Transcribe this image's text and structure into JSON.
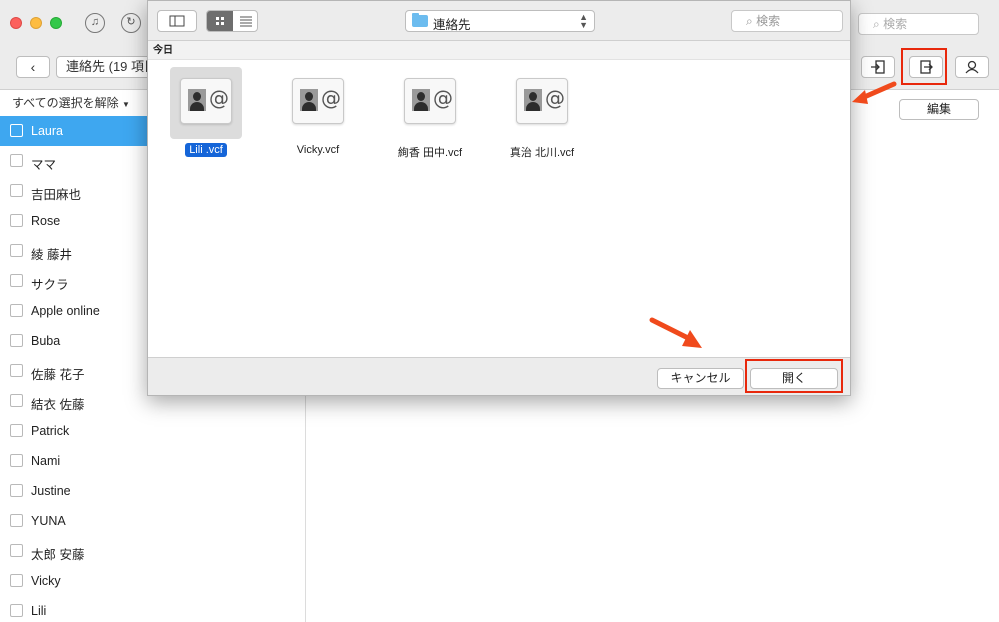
{
  "main": {
    "toolbar": {
      "back_icon": "‹",
      "title_label": "連絡先 (19 項目",
      "search_placeholder": "検索",
      "edit_label": "編集"
    },
    "sidebar": {
      "deselect_label": "すべての選択を解除",
      "contacts": [
        {
          "name": "Laura",
          "selected": true
        },
        {
          "name": "ママ"
        },
        {
          "name": "吉田麻也"
        },
        {
          "name": "Rose"
        },
        {
          "name": "綾 藤井"
        },
        {
          "name": "サクラ"
        },
        {
          "name": "Apple online"
        },
        {
          "name": "Buba"
        },
        {
          "name": "佐藤 花子"
        },
        {
          "name": "結衣 佐藤"
        },
        {
          "name": "Patrick"
        },
        {
          "name": "Nami"
        },
        {
          "name": "Justine"
        },
        {
          "name": "YUNA"
        },
        {
          "name": "太郎 安藤"
        },
        {
          "name": "Vicky"
        },
        {
          "name": "Lili"
        }
      ]
    }
  },
  "dialog": {
    "location": "連絡先",
    "search_placeholder": "検索",
    "section_label": "今日",
    "files": [
      {
        "name": "Lili .vcf",
        "selected": true
      },
      {
        "name": "Vicky.vcf"
      },
      {
        "name": "絢香 田中.vcf"
      },
      {
        "name": "真治 北川.vcf"
      }
    ],
    "cancel_label": "キャンセル",
    "open_label": "開く"
  },
  "colors": {
    "selection_blue": "#3ea7f0",
    "file_selection_blue": "#1565d8",
    "highlight_red": "#e8280c"
  },
  "icons": [
    "itunes-icon",
    "sync-icon",
    "search-icon",
    "import-icon",
    "export-icon",
    "contact-icon",
    "folder-icon",
    "vcard-icon"
  ]
}
